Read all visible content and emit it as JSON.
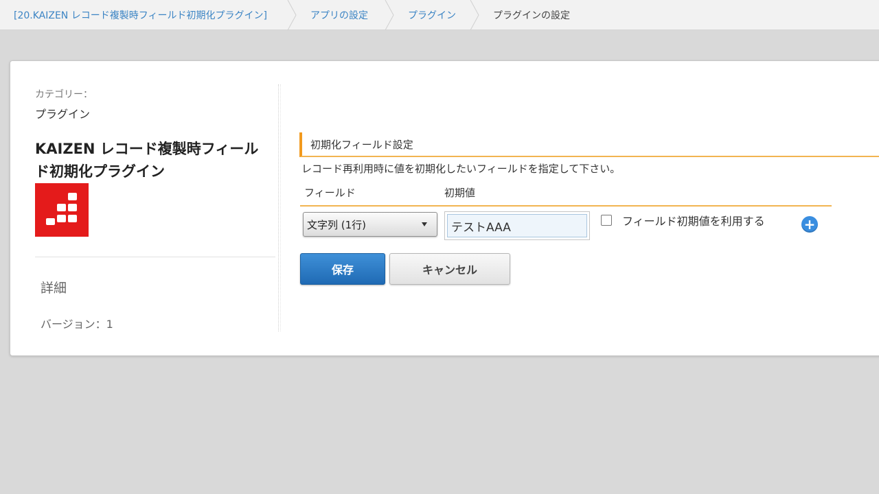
{
  "breadcrumb": [
    {
      "label": "[20.KAIZEN レコード複製時フィールド初期化プラグイン]"
    },
    {
      "label": "アプリの設定"
    },
    {
      "label": "プラグイン"
    },
    {
      "label": "プラグインの設定"
    }
  ],
  "sidebar": {
    "category_label": "カテゴリー：",
    "category_value": "プラグイン",
    "plugin_title": "KAIZEN レコード複製時フィールド初期化プラグイン",
    "logo_color": "#e41b1b",
    "detail_label": "詳細",
    "version_text": "バージョン：1"
  },
  "settings": {
    "section_title": "初期化フィールド設定",
    "description": "レコード再利用時に値を初期化したいフィールドを指定して下さい。",
    "columns": {
      "field": "フィールド",
      "initial_value": "初期値"
    },
    "row": {
      "field_select_value": "文字列 (1行)",
      "initial_value": "テストAAA",
      "use_initial_checkbox_label": "フィールド初期値を利用する",
      "use_initial_checked": false,
      "add_icon": "plus-circle-icon"
    },
    "accent_color": "#f29a1e"
  },
  "actions": {
    "save_label": "保存",
    "cancel_label": "キャンセル",
    "save_color": "#1f6ab4"
  }
}
